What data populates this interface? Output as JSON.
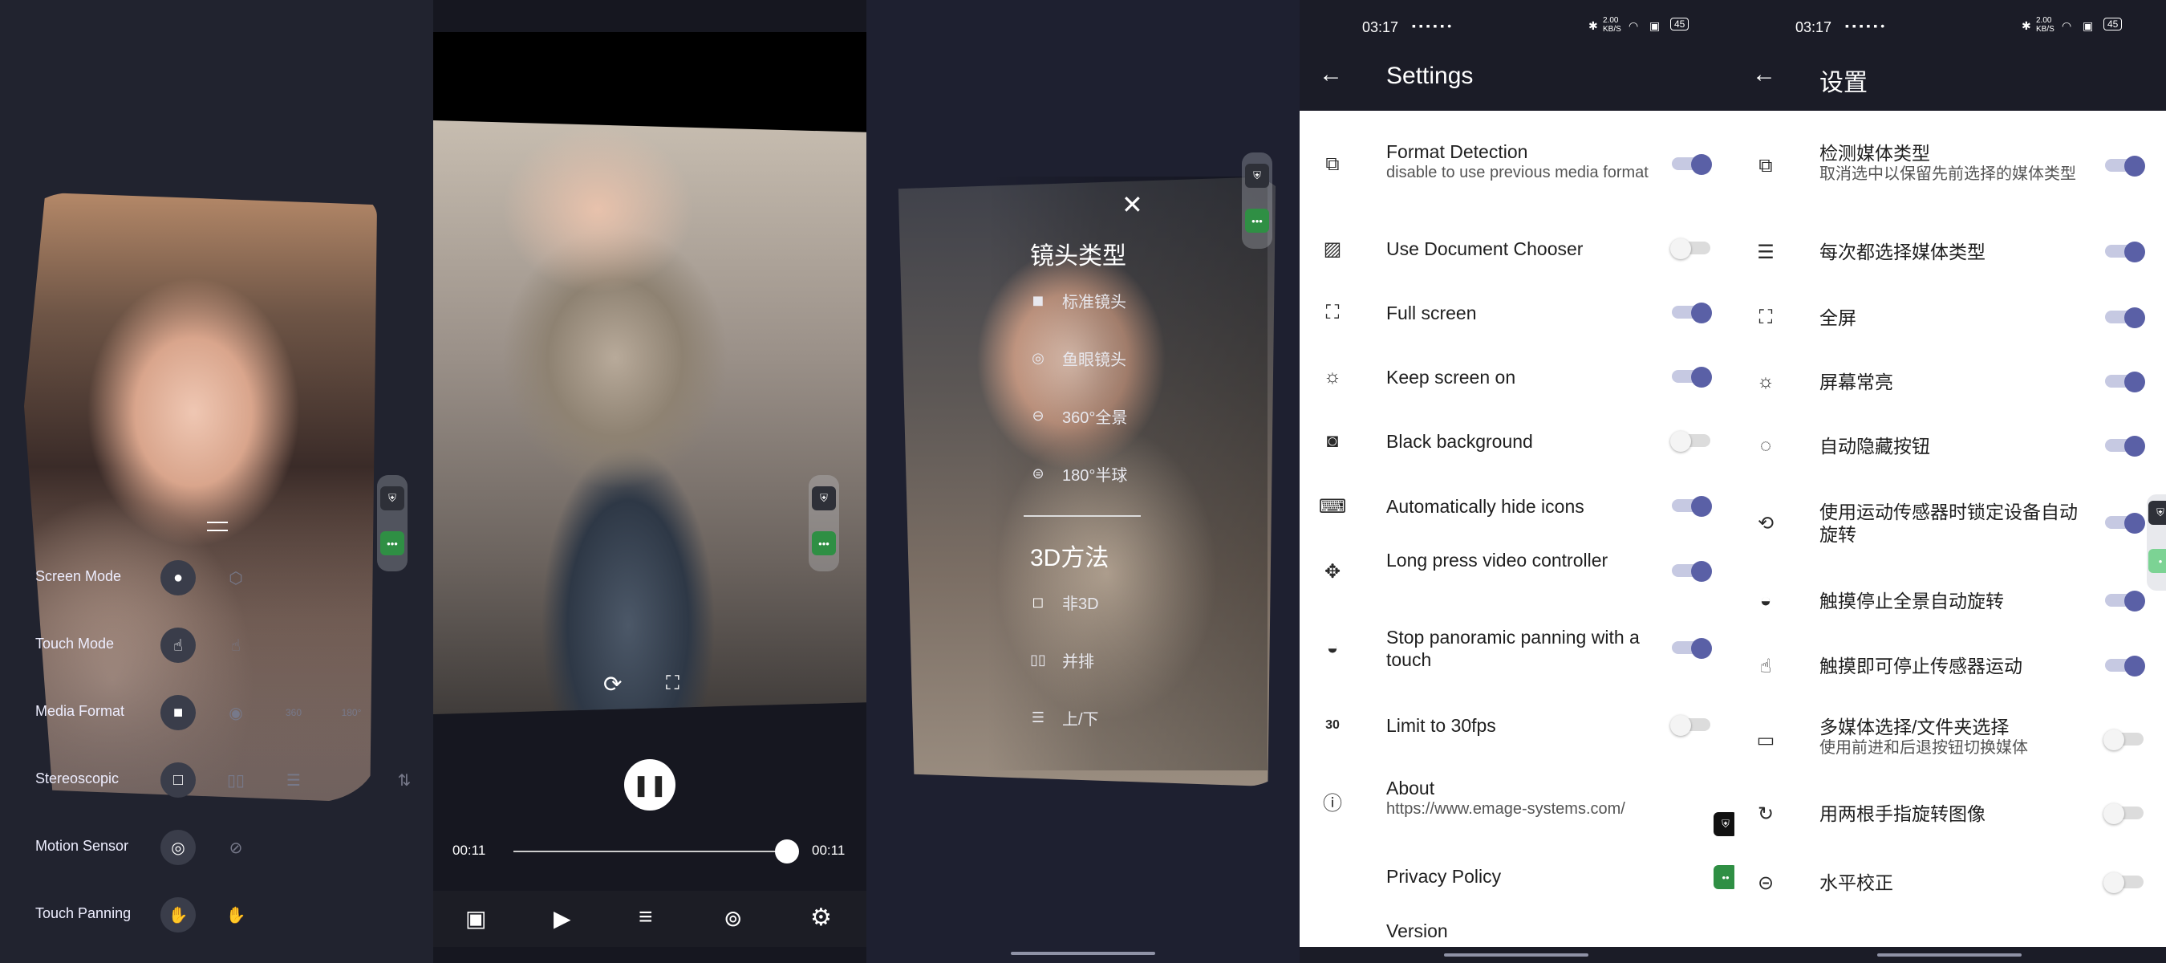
{
  "panel1": {
    "handle_icon": "drag-handle-icon",
    "rows": [
      {
        "label": "Screen Mode",
        "icons": [
          "screen-flat-icon",
          "screen-cube-icon"
        ]
      },
      {
        "label": "Touch Mode",
        "icons": [
          "touch-rotate-icon",
          "touch-rotate-off-icon"
        ]
      },
      {
        "label": "Media Format",
        "icons": [
          "square-icon",
          "circle-icon",
          "360",
          "180°"
        ]
      },
      {
        "label": "Stereoscopic",
        "icons": [
          "square-white-icon",
          "side-by-side-icon",
          "top-bottom-icon",
          "swap-icon"
        ]
      },
      {
        "label": "Motion Sensor",
        "icons": [
          "motion-sensor-icon",
          "motion-sensor-off-icon"
        ]
      },
      {
        "label": "Touch Panning",
        "icons": [
          "touch-pan-icon",
          "touch-pan-off-icon"
        ]
      }
    ]
  },
  "panel2": {
    "time_current": "00:11",
    "time_total": "00:11",
    "progress": 1.0,
    "bottom_nav": [
      "image-icon",
      "video-icon",
      "sliders-icon",
      "vr-headset-icon",
      "settings-gear-icon"
    ]
  },
  "panel3": {
    "lens_title": "镜头类型",
    "lens_options": [
      "标准镜头",
      "鱼眼镜头",
      "360°全景",
      "180°半球"
    ],
    "stereo_title": "3D方法",
    "stereo_options": [
      "非3D",
      "并排",
      "上/下"
    ]
  },
  "status": {
    "time": "03:17",
    "net_speed_top": "2.00",
    "net_speed_unit": "KB/S",
    "battery": "45"
  },
  "panel4": {
    "title": "Settings",
    "items": [
      {
        "title": "Format Detection",
        "subtitle": "disable to use previous media format",
        "on": true,
        "icon": "format-detection-icon"
      },
      {
        "title": "Use Document Chooser",
        "subtitle": "",
        "on": false,
        "icon": "photo-library-icon"
      },
      {
        "title": "Full screen",
        "subtitle": "",
        "on": true,
        "icon": "fullscreen-icon"
      },
      {
        "title": "Keep screen on",
        "subtitle": "",
        "on": true,
        "icon": "brightness-icon"
      },
      {
        "title": "Black background",
        "subtitle": "",
        "on": false,
        "icon": "black-background-icon"
      },
      {
        "title": "Automatically hide icons",
        "subtitle": "",
        "on": true,
        "icon": "keyboard-hide-icon"
      },
      {
        "title": "Long press video controller",
        "subtitle": "",
        "on": true,
        "icon": "move-arrows-icon"
      },
      {
        "title": "Stop panoramic panning with a touch",
        "subtitle": "",
        "on": true,
        "icon": "panorama-stop-icon"
      },
      {
        "title": "Limit to 30fps",
        "subtitle": "",
        "on": false,
        "icon": "fps-30-icon"
      },
      {
        "title": "About",
        "subtitle": "https://www.emage-systems.com/",
        "on": null,
        "icon": "info-icon"
      },
      {
        "title": "Privacy Policy",
        "subtitle": "",
        "on": null,
        "icon": ""
      },
      {
        "title": "Version",
        "subtitle": "",
        "on": null,
        "icon": ""
      }
    ]
  },
  "panel5": {
    "title": "设置",
    "items": [
      {
        "title": "检测媒体类型",
        "subtitle": "取消选中以保留先前选择的媒体类型",
        "on": true,
        "icon": "format-detection-icon"
      },
      {
        "title": "每次都选择媒体类型",
        "subtitle": "",
        "on": true,
        "icon": "list-choose-icon"
      },
      {
        "title": "全屏",
        "subtitle": "",
        "on": true,
        "icon": "fullscreen-icon"
      },
      {
        "title": "屏幕常亮",
        "subtitle": "",
        "on": true,
        "icon": "brightness-icon"
      },
      {
        "title": "自动隐藏按钮",
        "subtitle": "",
        "on": true,
        "icon": "dashed-circle-icon"
      },
      {
        "title": "使用运动传感器时锁定设备自动旋转",
        "subtitle": "",
        "on": true,
        "icon": "rotation-lock-icon"
      },
      {
        "title": "触摸停止全景自动旋转",
        "subtitle": "",
        "on": true,
        "icon": "panorama-stop-icon"
      },
      {
        "title": "触摸即可停止传感器运动",
        "subtitle": "",
        "on": true,
        "icon": "touch-stop-icon"
      },
      {
        "title": "多媒体选择/文件夹选择",
        "subtitle": "使用前进和后退按钮切换媒体",
        "on": false,
        "icon": "folder-code-icon"
      },
      {
        "title": "用两根手指旋转图像",
        "subtitle": "",
        "on": false,
        "icon": "two-finger-rotate-icon"
      },
      {
        "title": "水平校正",
        "subtitle": "",
        "on": false,
        "icon": "horizon-icon"
      }
    ]
  }
}
